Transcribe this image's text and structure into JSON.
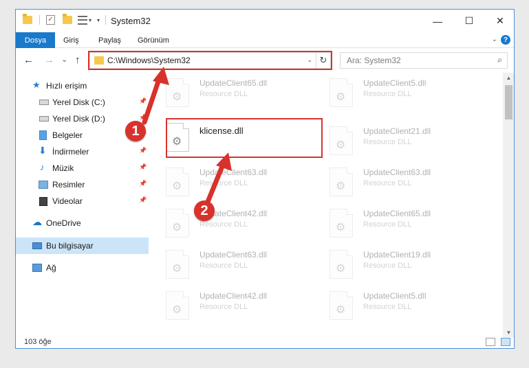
{
  "window": {
    "title": "System32",
    "minimize_glyph": "—",
    "maximize_glyph": "☐",
    "close_glyph": "✕"
  },
  "ribbon": {
    "tabs": [
      "Dosya",
      "Giriş",
      "Paylaş",
      "Görünüm"
    ],
    "collapse_glyph": "⌄",
    "help_glyph": "?",
    "accent": "#1979ca"
  },
  "navbar": {
    "back_glyph": "←",
    "forward_glyph": "→",
    "recent_glyph": "⌄",
    "up_glyph": "↑",
    "address": "C:\\Windows\\System32",
    "address_drop_glyph": "⌄",
    "refresh_glyph": "↻",
    "search_placeholder": "Ara: System32",
    "search_glyph": "⌕"
  },
  "sidebar": {
    "items": [
      {
        "label": "Hızlı erişim",
        "icon": "star-icon",
        "glyph": "★",
        "pinned": false
      },
      {
        "label": "Yerel Disk (C:)",
        "icon": "drive-icon",
        "pinned": true
      },
      {
        "label": "Yerel Disk (D:)",
        "icon": "drive-icon",
        "pinned": true
      },
      {
        "label": "Belgeler",
        "icon": "documents-icon",
        "pinned": true
      },
      {
        "label": "İndirmeler",
        "icon": "downloads-icon",
        "glyph": "⬇",
        "pinned": true
      },
      {
        "label": "Müzik",
        "icon": "music-icon",
        "glyph": "♪",
        "pinned": true
      },
      {
        "label": "Resimler",
        "icon": "pictures-icon",
        "pinned": true
      },
      {
        "label": "Videolar",
        "icon": "videos-icon",
        "pinned": true
      },
      {
        "label": "OneDrive",
        "icon": "cloud-icon",
        "glyph": "☁",
        "pinned": false
      },
      {
        "label": "Bu bilgisayar",
        "icon": "computer-icon",
        "pinned": false,
        "selected": true
      },
      {
        "label": "Ağ",
        "icon": "network-icon",
        "pinned": false
      }
    ],
    "pin_glyph": "📌"
  },
  "files": {
    "highlighted": {
      "name": "klicense.dll"
    },
    "left_column": [
      {
        "name": "UpdateClient65.dll",
        "type": "Resource DLL"
      },
      {
        "name": "UpdateClient63.dll",
        "type": "Resource DLL"
      },
      {
        "name": "UpdateClient42.dll",
        "type": "Resource DLL"
      },
      {
        "name": "UpdateClient63.dll",
        "type": "Resource DLL"
      },
      {
        "name": "UpdateClient42.dll",
        "type": "Resource DLL"
      }
    ],
    "right_column": [
      {
        "name": "UpdateClient5.dll",
        "type": "Resource DLL"
      },
      {
        "name": "UpdateClient21.dll",
        "type": "Resource DLL"
      },
      {
        "name": "UpdateClient63.dll",
        "type": "Resource DLL"
      },
      {
        "name": "UpdateClient65.dll",
        "type": "Resource DLL"
      },
      {
        "name": "UpdateClient19.dll",
        "type": "Resource DLL"
      },
      {
        "name": "UpdateClient5.dll",
        "type": "Resource DLL"
      }
    ],
    "gear_glyph": "⚙"
  },
  "status": {
    "count": "103 öğe"
  },
  "annotations": {
    "step1": "1",
    "step2": "2",
    "color": "#d8322c"
  }
}
